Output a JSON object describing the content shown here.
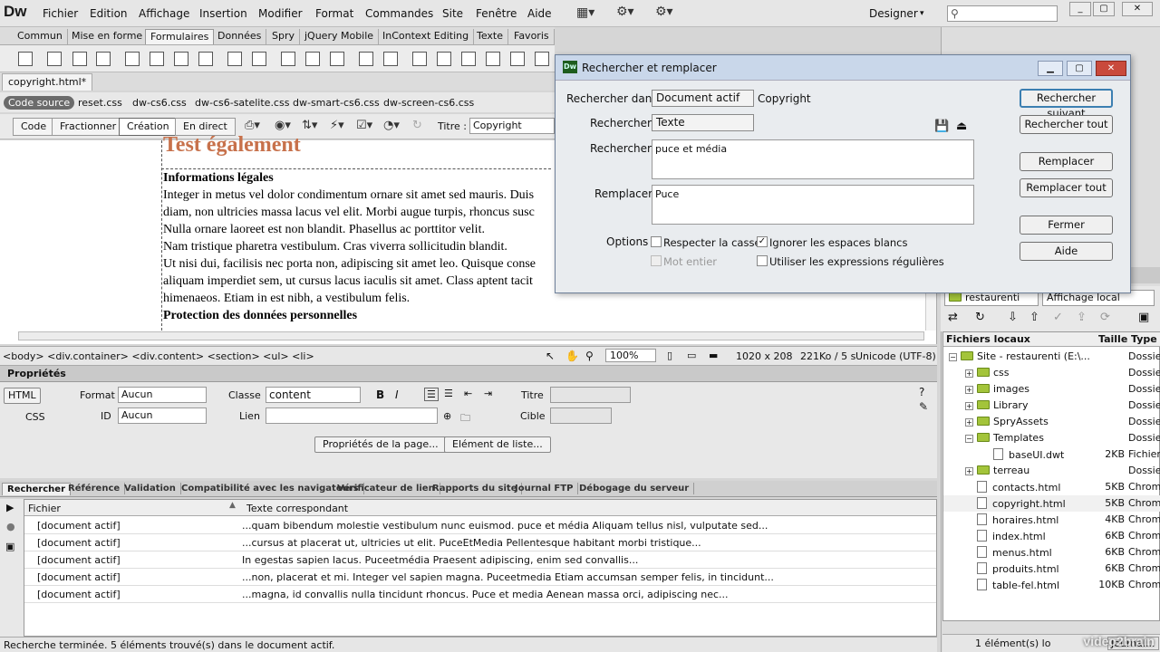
{
  "app": {
    "logo": "Dw",
    "menu": [
      "Fichier",
      "Edition",
      "Affichage",
      "Insertion",
      "Modifier",
      "Format",
      "Commandes",
      "Site",
      "Fenêtre",
      "Aide"
    ],
    "workspace": "Designer",
    "workspace_arrow": "▾",
    "search_icon": "⚲"
  },
  "insert_tabs": [
    "Commun",
    "Mise en forme",
    "Formulaires",
    "Données",
    "Spry",
    "jQuery Mobile",
    "InContext Editing",
    "Texte",
    "Favoris"
  ],
  "doc_tab": "copyright.html*",
  "related_files": {
    "source": "Code source",
    "files": [
      "reset.css",
      "dw-cs6.css",
      "dw-cs6-satelite.css",
      "dw-smart-cs6.css",
      "dw-screen-cs6.css"
    ]
  },
  "view_buttons": [
    "Code",
    "Fractionner",
    "Création",
    "En direct"
  ],
  "title_label": "Titre :",
  "title_value": "Copyright",
  "canvas": {
    "heading_big": "Test également",
    "lines": [
      {
        "text": "Informations légales",
        "bold": true
      },
      {
        "text": "Integer in metus vel dolor condimentum ornare sit amet sed mauris. Duis",
        "bold": false
      },
      {
        "text": "diam, non ultricies massa lacus vel elit. Morbi augue turpis, rhoncus susc",
        "bold": false
      },
      {
        "text": "Nulla ornare laoreet est non blandit. Phasellus ac porttitor velit.",
        "bold": false
      },
      {
        "text": "Nam tristique pharetra vestibulum. Cras viverra sollicitudin blandit.",
        "bold": false
      },
      {
        "text": "Ut nisi dui, facilisis nec porta non, adipiscing sit amet leo. Quisque conse",
        "bold": false
      },
      {
        "text": "aliquam imperdiet sem, ut cursus lacus iaculis sit amet. Class aptent tacit",
        "bold": false
      },
      {
        "text": "himenaeos. Etiam in est nibh, a vestibulum felis.",
        "bold": false
      },
      {
        "text": "Protection des données personnelles",
        "bold": true
      }
    ]
  },
  "statusbar": {
    "tags": "<body> <div.container> <div.content> <section> <ul> <li>",
    "zoom": "100%",
    "size": "1020 x 208",
    "weight": "221Ko / 5 s",
    "encoding": "Unicode (UTF-8)"
  },
  "properties": {
    "title": "Propriétés",
    "html_btn": "HTML",
    "css_btn": "CSS",
    "format_label": "Format",
    "format_value": "Aucun",
    "id_label": "ID",
    "id_value": "Aucun",
    "class_label": "Classe",
    "class_value": "content",
    "link_label": "Lien",
    "title_label": "Titre",
    "target_label": "Cible",
    "page_props_btn": "Propriétés de la page...",
    "list_item_btn": "Elément de liste..."
  },
  "results_tabs": [
    "Rechercher",
    "Référence",
    "Validation",
    "Compatibilité avec les navigateurs",
    "Vérificateur de lien",
    "Rapports du site",
    "Journal FTP",
    "Débogage du serveur"
  ],
  "results": {
    "col_file": "Fichier",
    "col_text": "Texte correspondant",
    "rows": [
      {
        "file": "[document actif]",
        "text": "...quam bibendum molestie vestibulum nunc euismod. puce et média Aliquam tellus nisl, vulputate sed..."
      },
      {
        "file": "[document actif]",
        "text": "...cursus at placerat ut, ultricies ut elit. PuceEtMedia Pellentesque habitant morbi tristique..."
      },
      {
        "file": "[document actif]",
        "text": "In egestas sapien lacus. Puceetmédia Praesent adipiscing, enim sed convallis..."
      },
      {
        "file": "[document actif]",
        "text": "...non, placerat et mi. Integer vel sapien magna. Puceetmedia Etiam accumsan semper felis, in tincidunt..."
      },
      {
        "file": "[document actif]",
        "text": "...magna, id convallis nulla tincidunt rhoncus. Puce et media Aenean massa orci, adipiscing nec..."
      }
    ]
  },
  "bottom_status": "Recherche terminée. 5 éléments trouvé(s) dans le document actif.",
  "files_panel": {
    "title": "Fichiers locaux",
    "site_select": "restaurenti",
    "view_select": "Affichage local",
    "col_name": "Fichiers locaux",
    "col_size": "Taille",
    "col_type": "Type",
    "rows": [
      {
        "name": "Site - restaurenti (E:\\...",
        "size": "",
        "type": "Dossie",
        "kind": "folder",
        "indent": 0
      },
      {
        "name": "css",
        "size": "",
        "type": "Dossie",
        "kind": "folder",
        "indent": 1
      },
      {
        "name": "images",
        "size": "",
        "type": "Dossie",
        "kind": "folder",
        "indent": 1
      },
      {
        "name": "Library",
        "size": "",
        "type": "Dossie",
        "kind": "folder",
        "indent": 1
      },
      {
        "name": "SpryAssets",
        "size": "",
        "type": "Dossie",
        "kind": "folder",
        "indent": 1
      },
      {
        "name": "Templates",
        "size": "",
        "type": "Dossie",
        "kind": "folder",
        "indent": 1
      },
      {
        "name": "baseUI.dwt",
        "size": "2KB",
        "type": "Fichier",
        "kind": "file",
        "indent": 2
      },
      {
        "name": "terreau",
        "size": "",
        "type": "Dossie",
        "kind": "folder",
        "indent": 1
      },
      {
        "name": "contacts.html",
        "size": "5KB",
        "type": "Chrom",
        "kind": "file",
        "indent": 1
      },
      {
        "name": "copyright.html",
        "size": "5KB",
        "type": "Chrom",
        "kind": "file",
        "indent": 1
      },
      {
        "name": "horaires.html",
        "size": "4KB",
        "type": "Chrom",
        "kind": "file",
        "indent": 1
      },
      {
        "name": "index.html",
        "size": "6KB",
        "type": "Chrom",
        "kind": "file",
        "indent": 1
      },
      {
        "name": "menus.html",
        "size": "6KB",
        "type": "Chrom",
        "kind": "file",
        "indent": 1
      },
      {
        "name": "produits.html",
        "size": "6KB",
        "type": "Chrom",
        "kind": "file",
        "indent": 1
      },
      {
        "name": "table-fel.html",
        "size": "10KB",
        "type": "Chrom",
        "kind": "file",
        "indent": 1
      }
    ],
    "footer": "1 élément(s) lo",
    "journal_btn": "Journal..."
  },
  "dialog": {
    "title": "Rechercher et remplacer",
    "search_in_label": "Rechercher dans :",
    "search_in_value": "Document actif",
    "search_in_extra": "Copyright",
    "search_type_label": "Rechercher :",
    "search_type_value": "Texte",
    "search_text_label": "Rechercher :",
    "search_text_value": "puce et média",
    "replace_label": "Remplacer :",
    "replace_value": "Puce",
    "options_label": "Options :",
    "opt_case": "Respecter la casse",
    "opt_whitespace": "Ignorer les espaces blancs",
    "opt_whole": "Mot entier",
    "opt_regex": "Utiliser les expressions régulières",
    "btn_next": "Rechercher suivant",
    "btn_all": "Rechercher tout",
    "btn_replace": "Remplacer",
    "btn_replace_all": "Remplacer tout",
    "btn_close": "Fermer",
    "btn_help": "Aide"
  },
  "watermark": "video2brain"
}
